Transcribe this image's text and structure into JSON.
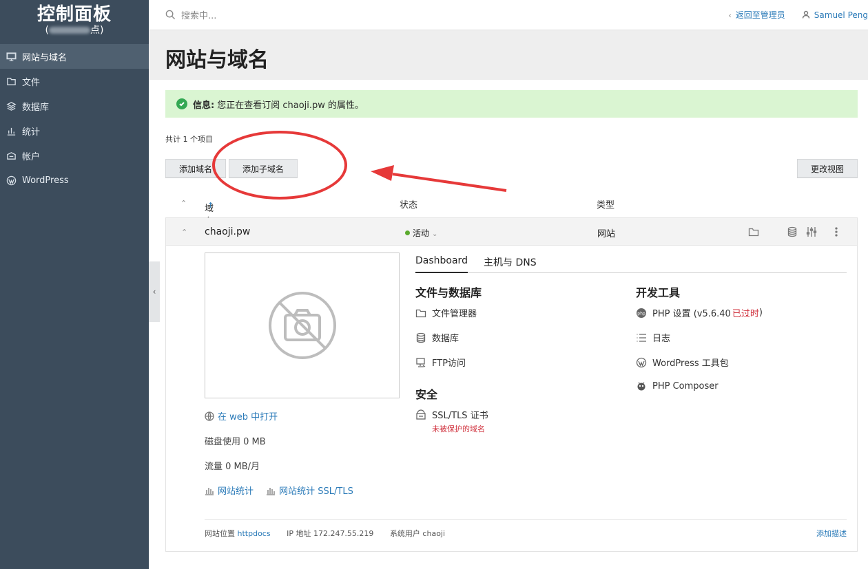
{
  "sidebar": {
    "brand_title": "控制面板",
    "brand_sub_left": "(",
    "brand_sub_right": "点)",
    "items": [
      {
        "label": "网站与域名",
        "icon": "monitor-icon",
        "active": true
      },
      {
        "label": "文件",
        "icon": "folder-icon"
      },
      {
        "label": "数据库",
        "icon": "layers-icon"
      },
      {
        "label": "统计",
        "icon": "bar-chart-icon"
      },
      {
        "label": "帐户",
        "icon": "account-icon"
      },
      {
        "label": "WordPress",
        "icon": "wordpress-icon"
      }
    ]
  },
  "topbar": {
    "search_placeholder": "搜索中...",
    "back_link": "返回至管理员",
    "user": "Samuel Peng"
  },
  "page": {
    "title": "网站与域名"
  },
  "info": {
    "label": "信息:",
    "text": "您正在查看订阅 chaoji.pw 的属性。"
  },
  "list": {
    "count_text": "共计 1 个项目",
    "add_domain": "添加域名",
    "add_subdomain": "添加子域名",
    "change_view": "更改视图",
    "columns": {
      "domain": "域名",
      "status": "状态",
      "type": "类型"
    }
  },
  "row": {
    "domain": "chaoji.pw",
    "status": "活动",
    "type": "网站",
    "open_web": "在 web 中打开",
    "disk": "磁盘使用 0 MB",
    "traffic": "流量 0 MB/月",
    "stats": "网站统计",
    "stats_ssl": "网站统计 SSL/TLS",
    "tabs": [
      "Dashboard",
      "主机与 DNS"
    ],
    "files_title": "文件与数据库",
    "file_manager": "文件管理器",
    "databases": "数据库",
    "ftp": "FTP访问",
    "security_title": "安全",
    "ssl": "SSL/TLS 证书",
    "ssl_warning": "未被保护的域名",
    "dev_title": "开发工具",
    "php_settings": "PHP 设置 (v5.6.40",
    "php_outdated": "已过时",
    "php_close": ")",
    "logs": "日志",
    "wp_toolkit": "WordPress 工具包",
    "composer": "PHP Composer",
    "footer": {
      "location_label": "网站位置",
      "location_value": "httpdocs",
      "ip": "IP 地址 172.247.55.219",
      "sys_user": "系统用户 chaoji",
      "add_desc": "添加描述"
    }
  },
  "colors": {
    "sidebar_bg": "#3c4c5c",
    "link": "#2a7ab8",
    "info_bg": "#daf5d2",
    "annotation_red": "#e63939",
    "status_green": "#5aaa2d",
    "warning_red": "#d0323e"
  }
}
